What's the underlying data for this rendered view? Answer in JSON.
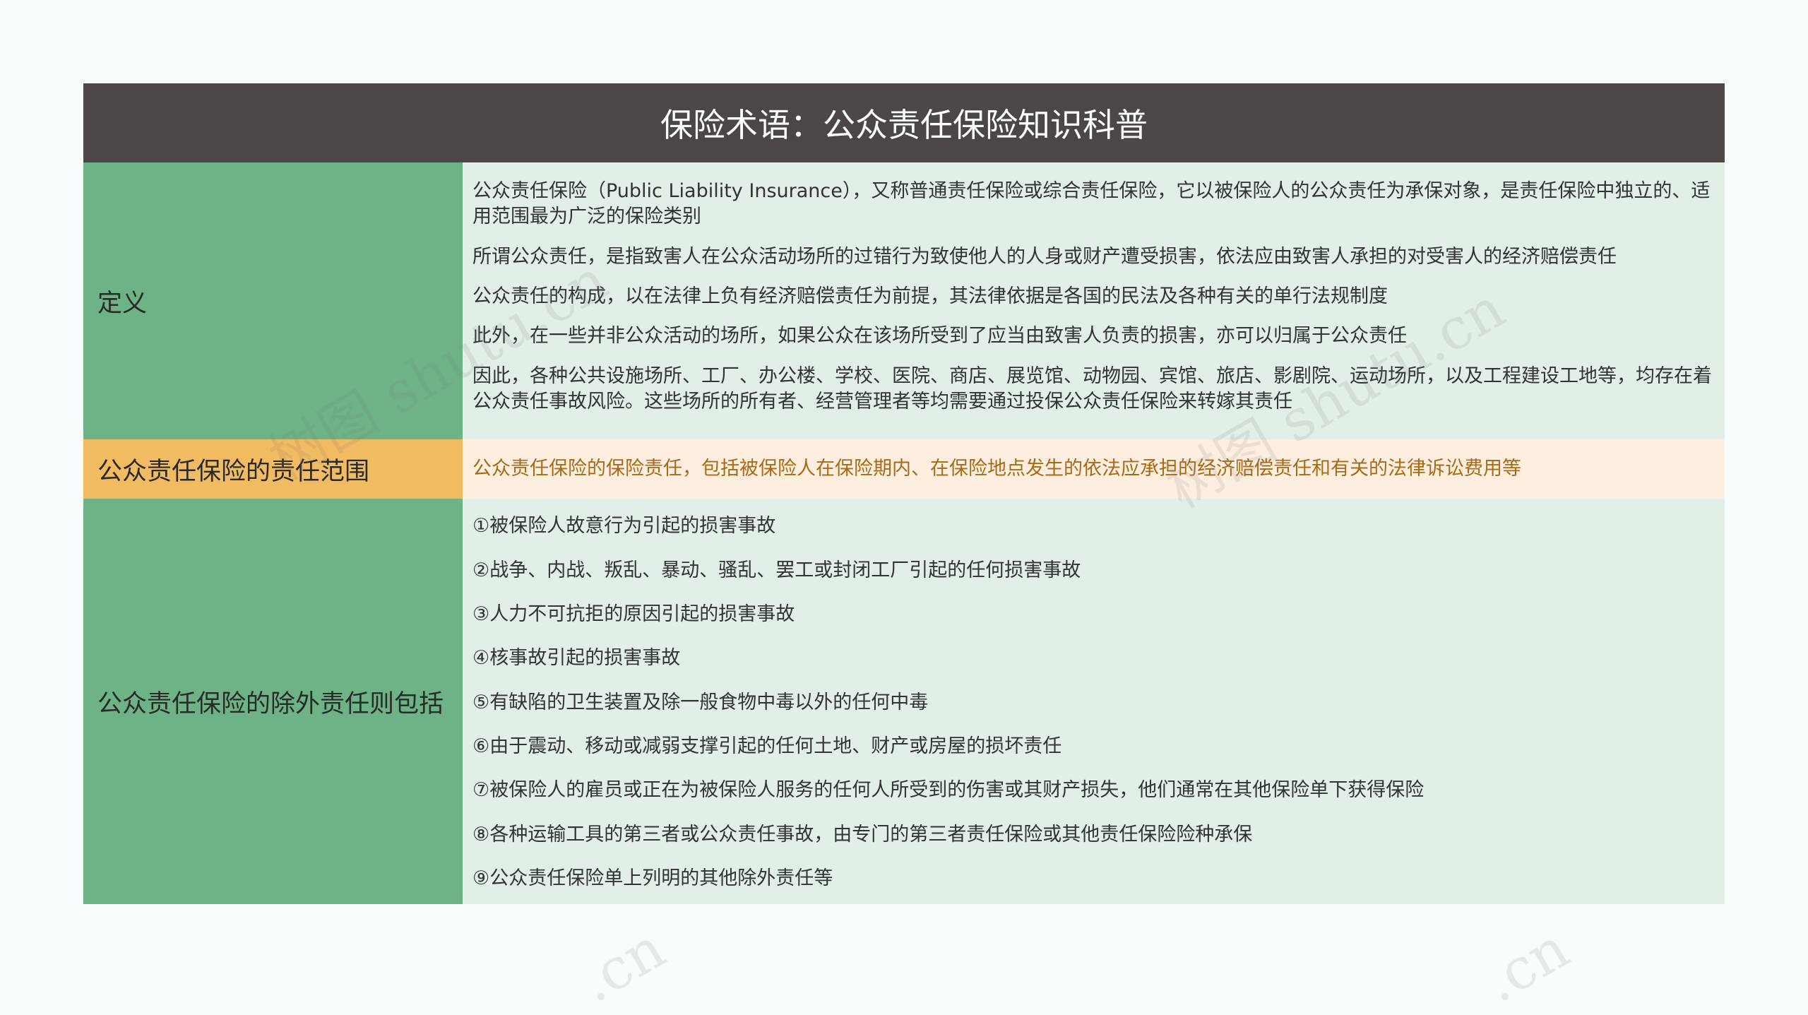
{
  "title": "保险术语：公众责任保险知识科普",
  "sections": [
    {
      "label": "定义",
      "items": [
        "公众责任保险（Public Liability Insurance），又称普通责任保险或综合责任保险，它以被保险人的公众责任为承保对象，是责任保险中独立的、适用范围最为广泛的保险类别",
        "所谓公众责任，是指致害人在公众活动场所的过错行为致使他人的人身或财产遭受损害，依法应由致害人承担的对受害人的经济赔偿责任",
        "公众责任的构成，以在法律上负有经济赔偿责任为前提，其法律依据是各国的民法及各种有关的单行法规制度",
        "此外，在一些并非公众活动的场所，如果公众在该场所受到了应当由致害人负责的损害，亦可以归属于公众责任",
        "因此，各种公共设施场所、工厂、办公楼、学校、医院、商店、展览馆、动物园、宾馆、旅店、影剧院、运动场所，以及工程建设工地等，均存在着公众责任事故风险。这些场所的所有者、经营管理者等均需要通过投保公众责任保险来转嫁其责任"
      ]
    },
    {
      "label": "公众责任保险的责任范围",
      "items": [
        "公众责任保险的保险责任，包括被保险人在保险期内、在保险地点发生的依法应承担的经济赔偿责任和有关的法律诉讼费用等"
      ]
    },
    {
      "label": "公众责任保险的除外责任则包括",
      "items": [
        "①被保险人故意行为引起的损害事故",
        "②战争、内战、叛乱、暴动、骚乱、罢工或封闭工厂引起的任何损害事故",
        "③人力不可抗拒的原因引起的损害事故",
        "④核事故引起的损害事故",
        "⑤有缺陷的卫生装置及除一般食物中毒以外的任何中毒",
        "⑥由于震动、移动或减弱支撑引起的任何土地、财产或房屋的损坏责任",
        "⑦被保险人的雇员或正在为被保险人服务的任何人所受到的伤害或其财产损失，他们通常在其他保险单下获得保险",
        "⑧各种运输工具的第三者或公众责任事故，由专门的第三者责任保险或其他责任保险险种承保",
        "⑨公众责任保险单上列明的其他除外责任等"
      ]
    }
  ],
  "watermarks": [
    "树图 shutu.cn",
    "树图 shutu.cn",
    ".cn",
    ".cn"
  ],
  "colors": {
    "title_bg": "#4c4647",
    "green_label": "#6db385",
    "green_content": "#e1efe6",
    "orange_label": "#f1bb62",
    "orange_content": "#fdeee0"
  }
}
